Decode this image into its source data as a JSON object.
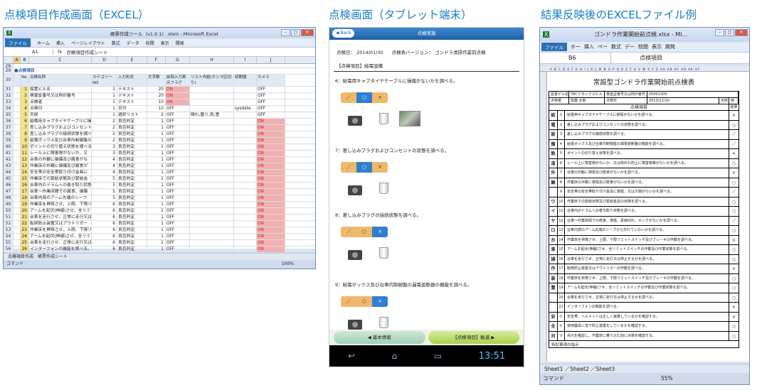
{
  "captions": {
    "left": "点検項目作成画面（EXCEL）",
    "middle": "点検画面（タブレット端末）",
    "right": "結果反映後のEXCELファイル例"
  },
  "excel1": {
    "title": "帳票作成ツール（v1.0.1）.xlsm - Microsoft Excel",
    "file_tab": "ファイル",
    "tabs": [
      "ホーム",
      "挿入",
      "ページレイアウト",
      "数式",
      "データ",
      "校閲",
      "表示",
      "開発"
    ],
    "namebox": "A1",
    "formula": "点検項目作成シート",
    "section_label": "■点検項目",
    "headers": [
      "No",
      "点検名称",
      "カテゴリーNO",
      "入力形式",
      "文字数",
      "前回入力表示フラグ",
      "リスト内容(カンマ区切り)",
      "初期値",
      "カメラ"
    ],
    "rows": [
      {
        "r": "31",
        "no": "1",
        "name": "設置ビル名",
        "cat": "1",
        "type": "テキスト",
        "len": "20",
        "flag": "ON",
        "list": "",
        "init": "",
        "cam": "OFF"
      },
      {
        "r": "32",
        "no": "2",
        "name": "検査証番号又は則印番号",
        "cat": "1",
        "type": "テキスト",
        "len": "20",
        "flag": "ON",
        "list": "",
        "init": "",
        "cam": "OFF"
      },
      {
        "r": "33",
        "no": "3",
        "name": "点検者",
        "cat": "1",
        "type": "テキスト",
        "len": "10",
        "flag": "ON",
        "list": "",
        "init": "",
        "cam": "OFF"
      },
      {
        "r": "34",
        "no": "4",
        "name": "点検日",
        "cat": "1",
        "type": "日付",
        "len": "10",
        "flag": "OFF",
        "list": "",
        "init": "sysdate",
        "cam": "OFF"
      },
      {
        "r": "35",
        "no": "5",
        "name": "天候",
        "cat": "1",
        "type": "選択リスト",
        "len": "2",
        "flag": "OFF",
        "list": "晴れ,曇り,雨,雪",
        "init": "",
        "cam": "OFF"
      },
      {
        "r": "36",
        "no": "6",
        "name": "給電用キャブタイヤケーブルに損",
        "cat": "2",
        "type": "良否判定",
        "len": "1",
        "flag": "OFF",
        "list": "",
        "init": "",
        "cam": "ON"
      },
      {
        "r": "37",
        "no": "7",
        "name": "差し込みプラグおよびコンセントの",
        "cat": "2",
        "type": "良否判定",
        "len": "1",
        "flag": "OFF",
        "list": "",
        "init": "",
        "cam": "ON"
      },
      {
        "r": "38",
        "no": "8",
        "name": "差し込みプラグの接続状態を調べる",
        "cat": "2",
        "type": "良否判定",
        "len": "1",
        "flag": "OFF",
        "list": "",
        "init": "",
        "cam": "ON"
      },
      {
        "r": "39",
        "no": "9",
        "name": "給電ボックス及び台車内制御盤の",
        "cat": "2",
        "type": "良否判定",
        "len": "1",
        "flag": "OFF",
        "list": "",
        "init": "",
        "cam": "ON"
      },
      {
        "r": "40",
        "no": "10",
        "name": "ポイントの切り替え状態を調べる",
        "cat": "3",
        "type": "良否判定",
        "len": "1",
        "flag": "OFF",
        "list": "",
        "init": "",
        "cam": "ON"
      },
      {
        "r": "41",
        "no": "11",
        "name": "レール上に障害物がないか、又",
        "cat": "3",
        "type": "良否判定",
        "len": "1",
        "flag": "OFF",
        "list": "",
        "init": "",
        "cam": "ON"
      },
      {
        "r": "42",
        "no": "12",
        "name": "台車の外観に損傷及び腐食がな",
        "cat": "4",
        "type": "良否判定",
        "len": "1",
        "flag": "OFF",
        "list": "",
        "init": "",
        "cam": "ON"
      },
      {
        "r": "43",
        "no": "13",
        "name": "作業床の外観に損傷及び腐食が",
        "cat": "4",
        "type": "良否判定",
        "len": "1",
        "flag": "OFF",
        "list": "",
        "init": "",
        "cam": "ON"
      },
      {
        "r": "44",
        "no": "14",
        "name": "安全帯の安全帯取り付け金具に",
        "cat": "4",
        "type": "良否判定",
        "len": "1",
        "flag": "OFF",
        "list": "",
        "init": "",
        "cam": "ON"
      },
      {
        "r": "45",
        "no": "15",
        "name": "作業床での緊結状態及び緊結金",
        "cat": "5",
        "type": "良否判定",
        "len": "1",
        "flag": "OFF",
        "list": "",
        "init": "",
        "cam": "ON"
      },
      {
        "r": "46",
        "no": "16",
        "name": "台車内のドラムへの巻き取り状態",
        "cat": "5",
        "type": "良否判定",
        "len": "1",
        "flag": "OFF",
        "list": "",
        "init": "",
        "cam": "ON"
      },
      {
        "r": "47",
        "no": "17",
        "name": "台車～作業床間での腐食、損傷",
        "cat": "5",
        "type": "良否判定",
        "len": "1",
        "flag": "OFF",
        "list": "",
        "init": "",
        "cam": "ON"
      },
      {
        "r": "48",
        "no": "18",
        "name": "台車内部のアーム先端のシーブ",
        "cat": "5",
        "type": "良否判定",
        "len": "1",
        "flag": "OFF",
        "list": "",
        "init": "",
        "cam": "ON"
      },
      {
        "r": "49",
        "no": "19",
        "name": "作業床を昇降させ、上限、下限リ",
        "cat": "6",
        "type": "良否判定",
        "len": "1",
        "flag": "OFF",
        "list": "",
        "init": "",
        "cam": "ON"
      },
      {
        "r": "50",
        "no": "20",
        "name": "アームを起伏(伸縮)させ、全リミ",
        "cat": "6",
        "type": "良否判定",
        "len": "1",
        "flag": "OFF",
        "list": "",
        "init": "",
        "cam": "ON"
      },
      {
        "r": "51",
        "no": "21",
        "name": "台車を走行させ、正常に走行又は",
        "cat": "6",
        "type": "良否判定",
        "len": "1",
        "flag": "OFF",
        "list": "",
        "init": "",
        "cam": "ON"
      },
      {
        "r": "52",
        "no": "22",
        "name": "転倒防止装置又はアウトリガー",
        "cat": "6",
        "type": "良否判定",
        "len": "1",
        "flag": "OFF",
        "list": "",
        "init": "",
        "cam": "ON"
      },
      {
        "r": "53",
        "no": "23",
        "name": "作業床を昇降させ、上限、下限リ",
        "cat": "6",
        "type": "良否判定",
        "len": "1",
        "flag": "OFF",
        "list": "",
        "init": "",
        "cam": "ON"
      },
      {
        "r": "54",
        "no": "24",
        "name": "アームを起伏(伸縮)させ、全リミ",
        "cat": "6",
        "type": "良否判定",
        "len": "1",
        "flag": "OFF",
        "list": "",
        "init": "",
        "cam": "ON"
      },
      {
        "r": "55",
        "no": "25",
        "name": "台車を走行させ、正常に走行又は",
        "cat": "6",
        "type": "良否判定",
        "len": "1",
        "flag": "OFF",
        "list": "",
        "init": "",
        "cam": "ON"
      },
      {
        "r": "56",
        "no": "26",
        "name": "インターフォンの機能を調べる。",
        "cat": "6",
        "type": "良否判定",
        "len": "1",
        "flag": "OFF",
        "list": "",
        "init": "",
        "cam": "ON"
      },
      {
        "r": "57",
        "no": "27",
        "name": "安全帯、ヘルメットは正しく装着",
        "cat": "7",
        "type": "良否判定",
        "len": "1",
        "flag": "OFF",
        "list": "",
        "init": "",
        "cam": "ON"
      },
      {
        "r": "58",
        "no": "28",
        "name": "使用器具に落下防止装置をして",
        "cat": "7",
        "type": "良否判定",
        "len": "1",
        "flag": "OFF",
        "list": "",
        "init": "",
        "cam": "ON"
      }
    ],
    "sheet_tabs": "点検項目作成　帳票作成シート",
    "status_left": "コマンド",
    "zoom": "100%"
  },
  "tablet": {
    "back": "Back",
    "header": "点検実施",
    "date_label": "点検日：",
    "date": "2014/01/30",
    "version_label": "点検表バージョン：",
    "version": "ゴンドラ清掃作業前点検",
    "section": "【点検項目】給電設備",
    "questions": [
      {
        "text": "6：給電用キャブタイヤケーブルに損傷がないかを調べる。",
        "sel": 1,
        "photo": true
      },
      {
        "text": "7：差し込みプラグおよびコンセントの状態を調べる。",
        "sel": 1,
        "photo": false
      },
      {
        "text": "8：差し込みプラグの接続状態を調べる。",
        "sel": 2,
        "photo": false
      },
      {
        "text": "9：給電ボックス及び台車内制御盤の漏電遮断器の機能を調べる。",
        "sel": 2,
        "photo": false
      }
    ],
    "seg_labels": [
      "／",
      "○",
      "×"
    ],
    "btn_left": "基本情報",
    "btn_right": "【点検項目】軌道",
    "clock": "13:51"
  },
  "excel2": {
    "title": "ゴンドラ作業開始前点検.xlsx - Mi...",
    "file_tab": "ファイル",
    "tabs": [
      "ホー",
      "挿入",
      "ペー",
      "数式",
      "デー",
      "校閲",
      "表示",
      "開発"
    ],
    "namebox": "B6",
    "formula": "点検項目",
    "doc_title": "常設型ゴンドラ作業開始前点検表",
    "info": [
      "設置ビル名",
      "TRCテネックスビル",
      "検査証番号又は則印番号",
      "00001309",
      "点検者",
      "佐藤 太郎",
      "点検日",
      "2013/12/10",
      "天候",
      "雨"
    ],
    "col_header": "点検項目",
    "col_result": "結果",
    "items": [
      {
        "g": "給",
        "no": "1",
        "text": "給電用キャブタイヤケーブルに損傷がないかを調べる。",
        "r": "×"
      },
      {
        "g": "電",
        "no": "2",
        "text": "差し込みプラグおよびコンセントの状態を調べる。",
        "r": "○"
      },
      {
        "g": "設",
        "no": "3",
        "text": "差し込みプラグの接続状態を調べる。",
        "r": "／"
      },
      {
        "g": "備",
        "no": "4",
        "text": "給電ボックス及び台車内制御盤の漏電遮断器の機能を調べる。",
        "r": "／"
      },
      {
        "g": "軌",
        "no": "5",
        "text": "ポイントの切り替え状態を調べる。",
        "r": "×"
      },
      {
        "g": "道",
        "no": "6",
        "text": "レール上に障害物がないか、又は荷外れ防止に障害物等がないかを調べる。",
        "r": "○"
      },
      {
        "g": "外",
        "no": "7",
        "text": "台車の外観に損傷及び腐食がないかを調べる。",
        "r": "×"
      },
      {
        "g": "観",
        "no": "8",
        "text": "作業床の外観に損傷及び腐食がないかを調べる。",
        "r": "○"
      },
      {
        "g": "",
        "no": "9",
        "text": "安全帯の安全帯取り付け金具に損傷、又は欠損がないかを調べる。",
        "r": "／"
      },
      {
        "g": "ワ",
        "no": "10",
        "text": "作業床での緊結状態及び緊結金具の状態を調べる。",
        "r": "○"
      },
      {
        "g": "イ",
        "no": "11",
        "text": "台車内のドラムへの巻き取り状態を調べる。",
        "r": "○"
      },
      {
        "g": "ヤ",
        "no": "12",
        "text": "台車～作業床間での腐食、損傷、素線切れ、キンクがないかを調べる。",
        "r": "／"
      },
      {
        "g": "ロ",
        "no": "13",
        "text": "台車内部のアーム先端のシーブから外れていないかを調べる。",
        "r": "○"
      },
      {
        "g": "台",
        "no": "14",
        "text": "作業床を昇降させ、上限、下限リミットスイッチ及びブレーキの作動を調べる。",
        "r": "×"
      },
      {
        "g": "車",
        "no": "15",
        "text": "アームを起伏(伸縮)させ、全リミットスイッチの作動及び作業状態を調べる。",
        "r": "○"
      },
      {
        "g": "操",
        "no": "16",
        "text": "台車を走行させ、正常に走行又は停止するかを調べる。",
        "r": "○"
      },
      {
        "g": "作",
        "no": "17",
        "text": "転倒防止装置又はアウトリガーの作動を調べる。",
        "r": "×"
      },
      {
        "g": "装",
        "no": "18",
        "text": "作業床を昇降させ、上限、下限リミットスイッチ及びブレーキの作動を調べる。",
        "r": "○"
      },
      {
        "g": "置",
        "no": "19",
        "text": "アームを起伏(伸縮)させ、全リミットスイッチの作動及び作業状態を調べる。",
        "r": "○"
      },
      {
        "g": "",
        "no": "20",
        "text": "台車を走行させ、正常に走行又は停止するかを調べる。",
        "r": "○"
      },
      {
        "g": "",
        "no": "21",
        "text": "インターフォンの機能を調べる。",
        "r": "×"
      },
      {
        "g": "安",
        "no": "①",
        "text": "安全帯、ヘルメットは正しく装着しているかを確認する。",
        "r": "×"
      },
      {
        "g": "全",
        "no": "②",
        "text": "使用器具に落下防止装置をしているかを確認する。",
        "r": "○"
      },
      {
        "g": "対",
        "no": "③",
        "text": "吊元を確認し、作業床に乗り込む前に点検を確認する。",
        "r": "○"
      }
    ],
    "footer": "特記事項の指示",
    "sheet_tabs": "Sheet1 ／Sheet2 ／Sheet3",
    "status_left": "コマンド",
    "zoom": "55%"
  }
}
